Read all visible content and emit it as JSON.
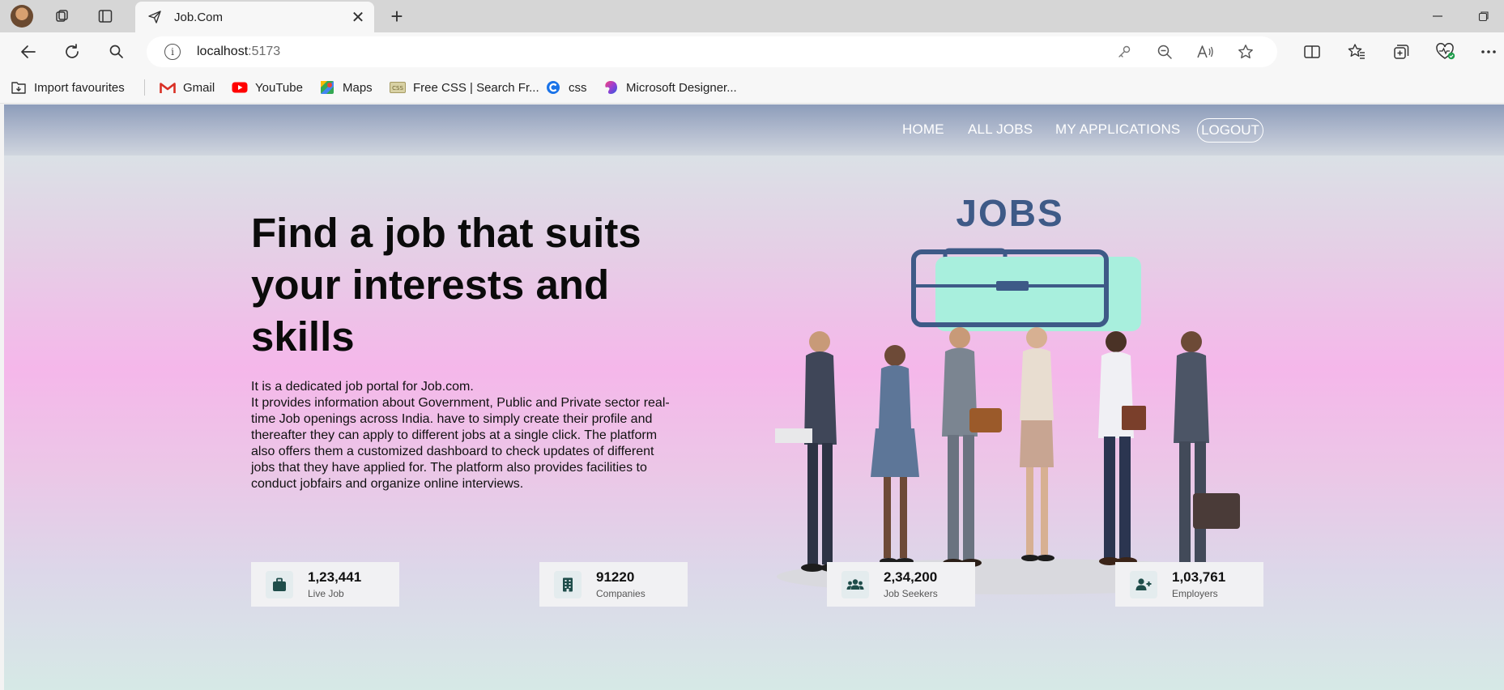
{
  "browser": {
    "tab_title": "Job.Com",
    "url_host": "localhost",
    "url_port": ":5173",
    "icons": [
      "profile-avatar",
      "workspaces-icon",
      "tab-actions-icon",
      "send-icon",
      "close-icon",
      "plus-icon",
      "back-icon",
      "refresh-icon",
      "search-icon",
      "info-icon",
      "key-icon",
      "zoom-out-icon",
      "read-aloud-icon",
      "star-icon",
      "split-screen-icon",
      "favorites-icon",
      "collections-icon",
      "health-icon",
      "more-icon"
    ]
  },
  "bookmarks": [
    {
      "label": "Import favourites",
      "icon": "import-icon"
    },
    {
      "label": "Gmail",
      "icon": "gmail-icon"
    },
    {
      "label": "YouTube",
      "icon": "youtube-icon"
    },
    {
      "label": "Maps",
      "icon": "maps-icon"
    },
    {
      "label": "Free CSS | Search Fr...",
      "icon": "css-site-icon"
    },
    {
      "label": "css",
      "icon": "css-icon"
    },
    {
      "label": "Microsoft Designer...",
      "icon": "designer-icon"
    }
  ],
  "nav": {
    "home": "HOME",
    "all_jobs": "ALL JOBS",
    "my_applications": "MY APPLICATIONS",
    "logout": "LOGOUT"
  },
  "hero": {
    "title": "Find a job that suits your interests and skills",
    "desc_line1": "It is a dedicated job portal for Job.com.",
    "desc_line2": "It provides information about Government, Public and Private sector real-time Job openings across India. have to simply create their profile and thereafter they can apply to different jobs at a single click. The platform also offers them a customized dashboard to check updates of different jobs that they have applied for. The platform also provides facilities to conduct jobfairs and organize online interviews.",
    "image_text": "JOBS"
  },
  "stats": [
    {
      "value": "1,23,441",
      "label": "Live Job",
      "icon": "briefcase-icon"
    },
    {
      "value": "91220",
      "label": "Companies",
      "icon": "building-icon"
    },
    {
      "value": "2,34,200",
      "label": "Job Seekers",
      "icon": "users-icon"
    },
    {
      "value": "1,03,761",
      "label": "Employers",
      "icon": "user-plus-icon"
    }
  ],
  "colors": {
    "accent_icon": "#1f4d4a",
    "jobs_logo": "#3e5a87",
    "briefcase_fill": "#a8efdd"
  }
}
